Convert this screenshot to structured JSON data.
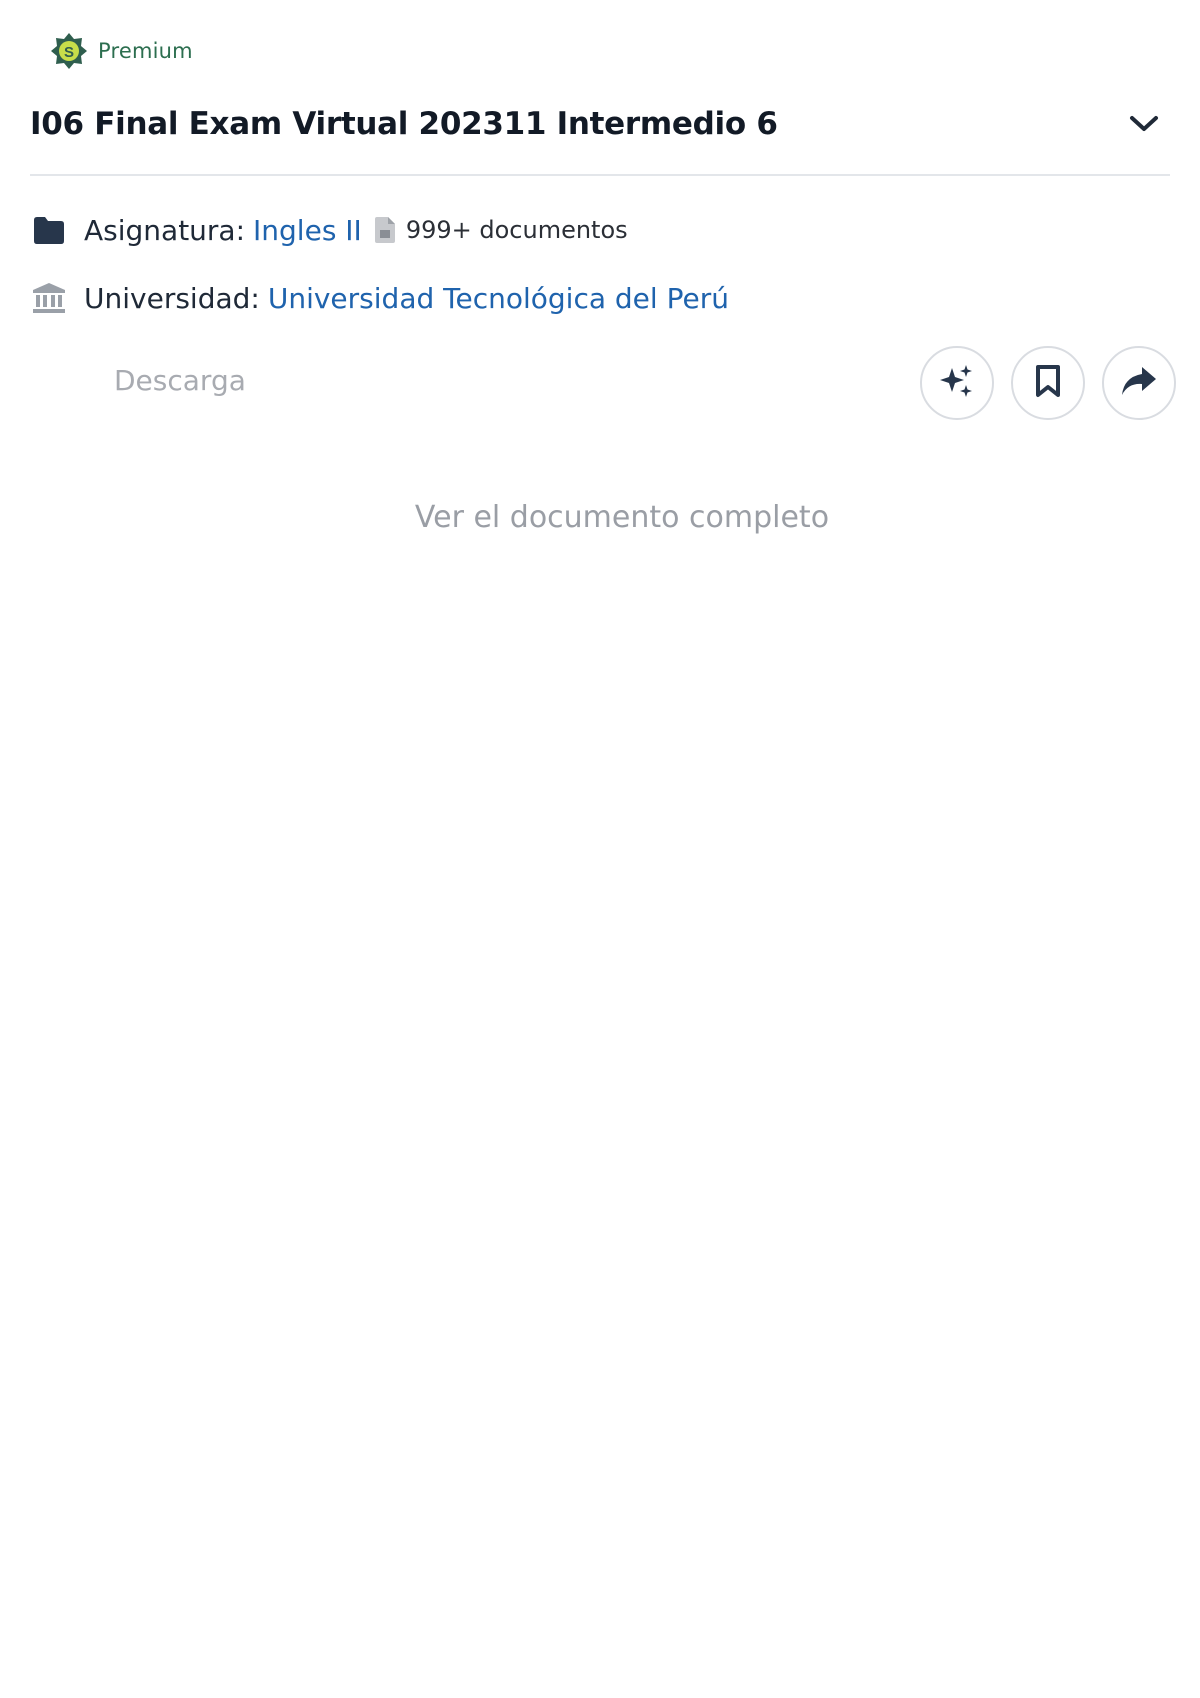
{
  "premium": {
    "label": "Premium",
    "badge_icon": "premium-badge-icon",
    "colors": {
      "badge_outer": "#2f5e4e",
      "badge_inner": "#c7de4a",
      "label": "#2c6e4f"
    }
  },
  "document": {
    "title": "I06 Final Exam Virtual 202311 Intermedio 6",
    "expand_icon": "chevron-down-icon"
  },
  "meta": {
    "course": {
      "icon": "folder-icon",
      "label": "Asignatura:",
      "value": "Ingles II",
      "count_icon": "document-icon",
      "count_text": "999+ documentos"
    },
    "university": {
      "icon": "institution-icon",
      "label": "Universidad:",
      "value": "Universidad Tecnológica del Perú"
    },
    "link_color": "#1f63ad"
  },
  "actions": {
    "download_label": "Descarga",
    "buttons": [
      {
        "name": "ai-assistant",
        "icon": "sparkles-icon"
      },
      {
        "name": "save",
        "icon": "bookmark-icon"
      },
      {
        "name": "share",
        "icon": "share-arrow-icon"
      }
    ]
  },
  "footer": {
    "view_full_label": "Ver el documento completo"
  }
}
